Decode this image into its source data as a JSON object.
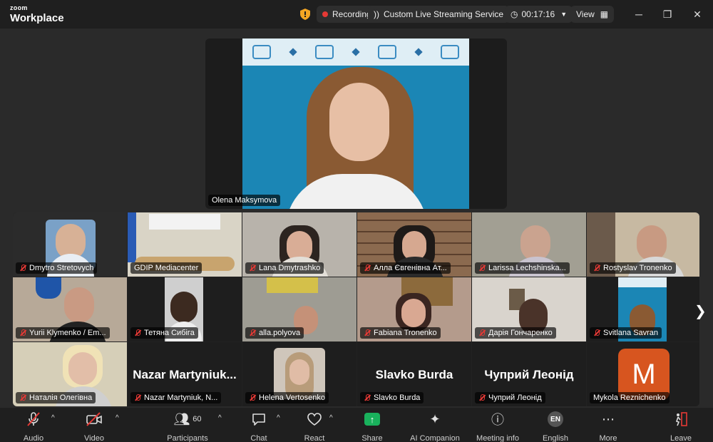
{
  "app": {
    "brand_small": "zoom",
    "brand_large": "Workplace"
  },
  "titlebar": {
    "recording": "Recording",
    "streaming": "Custom Live Streaming Service",
    "timer": "00:17:16",
    "view": "View"
  },
  "speaker": {
    "name": "Olena Maksymova"
  },
  "gallery": {
    "tiles": [
      {
        "name": "Dmytro Stretovych",
        "muted": true
      },
      {
        "name": "GDIP Mediacenter",
        "muted": false
      },
      {
        "name": "Lana Dmytrashko",
        "muted": true
      },
      {
        "name": "Алла Євгенівна Ат...",
        "muted": true
      },
      {
        "name": "Larissa Lechshinska...",
        "muted": true
      },
      {
        "name": "Rostyslav Tronenko",
        "muted": true
      },
      {
        "name": "Yurii Klymenko / Em...",
        "muted": true
      },
      {
        "name": "Тетяна Сибіга",
        "muted": true
      },
      {
        "name": "alla.polyova",
        "muted": true
      },
      {
        "name": "Fabiana Tronenko",
        "muted": true
      },
      {
        "name": "Дарія Гончаренко",
        "muted": true
      },
      {
        "name": "Svitlana Savran",
        "muted": true
      },
      {
        "name": "Наталія Олегівна",
        "muted": true
      },
      {
        "name": "Nazar Martyniuk, N...",
        "display": "Nazar  Martyniuk...",
        "muted": true
      },
      {
        "name": "Helena Vertosenko",
        "muted": true
      },
      {
        "name": "Slavko Burda",
        "display": "Slavko Burda",
        "muted": true
      },
      {
        "name": "Чуприй Леонід",
        "display": "Чуприй Леонід",
        "muted": true
      },
      {
        "name": "Mykola Reznichenko",
        "avatar_letter": "M",
        "muted": false
      }
    ]
  },
  "toolbar": {
    "audio": "Audio",
    "video": "Video",
    "participants": "Participants",
    "participants_count": "60",
    "chat": "Chat",
    "react": "React",
    "share": "Share",
    "ai": "AI Companion",
    "meeting_info": "Meeting info",
    "language": "English",
    "language_code": "EN",
    "more": "More",
    "leave": "Leave"
  },
  "colors": {
    "recording_dot": "#e53935",
    "share": "#19b15c",
    "avatar_m": "#d7551f",
    "speaker_bg": "#1b86b5"
  }
}
